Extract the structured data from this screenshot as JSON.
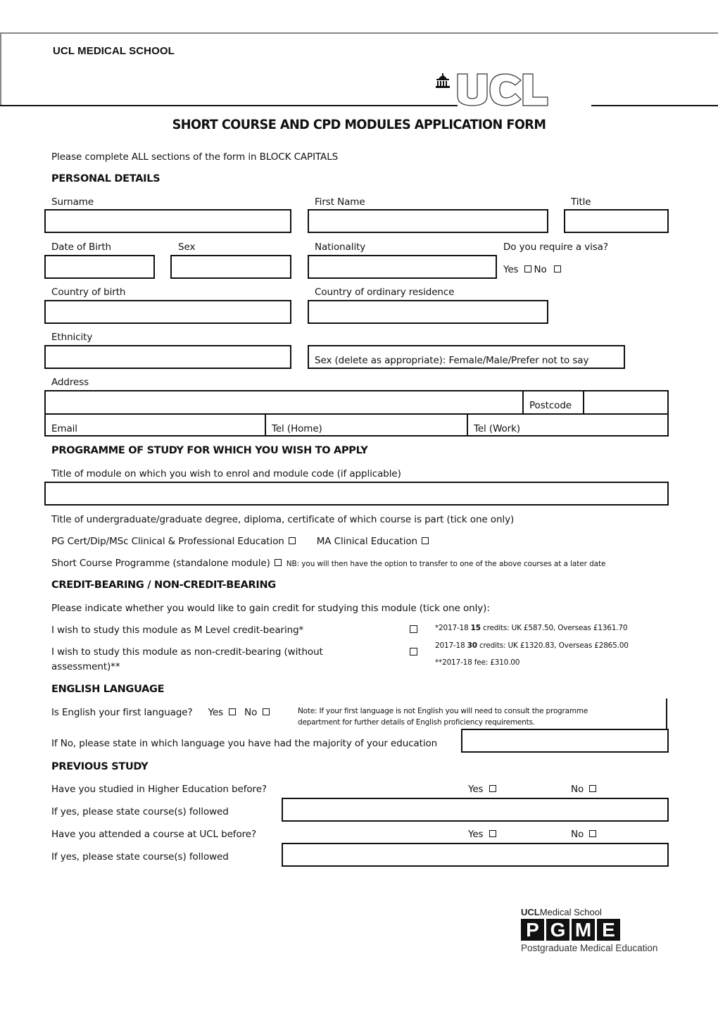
{
  "header": {
    "school": "UCL MEDICAL SCHOOL",
    "logo_text": "UCL",
    "form_title": "SHORT COURSE AND CPD MODULES APPLICATION FORM"
  },
  "instruction": "Please complete ALL sections of the form in BLOCK CAPITALS",
  "personal": {
    "heading": "PERSONAL DETAILS",
    "surname": "Surname",
    "first_name": "First Name",
    "title": "Title",
    "dob": "Date of Birth",
    "sex": "Sex",
    "nationality": "Nationality",
    "visa_question": "Do you require a visa?",
    "yes": "Yes",
    "no": "No",
    "country_birth": "Country of birth",
    "country_residence": "Country of ordinary residence",
    "ethnicity": "Ethnicity",
    "sex_delete": "Sex (delete as appropriate): Female/Male/Prefer not to say",
    "address": "Address",
    "postcode": "Postcode",
    "email": "Email",
    "tel_home": "Tel (Home)",
    "tel_work": "Tel (Work)"
  },
  "programme": {
    "heading": "PROGRAMME OF STUDY FOR WHICH YOU WISH TO APPLY",
    "module_title": "Title of module on which you wish to enrol and module code (if applicable)",
    "degree_title": "Title of undergraduate/graduate degree, diploma, certificate of which course is part (tick one only)",
    "option_pg": "PG Cert/Dip/MSc Clinical & Professional Education",
    "option_ma": "MA Clinical Education",
    "option_short": "Short Course Programme (standalone module)",
    "nb": "NB: you will then have the option to transfer to one of the above courses at a later date"
  },
  "credit": {
    "heading": "CREDIT-BEARING / NON-CREDIT-BEARING",
    "intro": "Please indicate whether you would like to gain credit for studying this module (tick one only):",
    "option_m": "I wish to study this module as M Level credit-bearing*",
    "option_non_1": "I wish to study this module as non-credit-bearing (without",
    "option_non_2": "assessment)**",
    "fee1_pre": "*2017-18 ",
    "fee1_bold": "15",
    "fee1_post": " credits: UK £587.50, Overseas £1361.70",
    "fee2_pre": "2017-18 ",
    "fee2_bold": "30",
    "fee2_post": " credits: UK £1320.83, Overseas £2865.00",
    "fee3": "**2017-18 fee: £310.00"
  },
  "english": {
    "heading": "ENGLISH LANGUAGE",
    "question": "Is English your first language?",
    "yes": "Yes",
    "no": "No",
    "note_1": "Note: If your first language is not English you will need to consult the programme",
    "note_2": "department for further details of English proficiency requirements.",
    "if_no": "If No, please state in which language you have had the majority of your education"
  },
  "previous": {
    "heading": "PREVIOUS STUDY",
    "q1": "Have you studied in Higher Education before?",
    "q1_followed": "If yes, please state course(s) followed",
    "q2": "Have you attended a course at UCL before?",
    "q2_followed": "If yes, please state course(s) followed",
    "yes": "Yes",
    "no": "No"
  },
  "footer_logo": {
    "ucl": "UCL",
    "medical_school": "Medical School",
    "letters": [
      "P",
      "G",
      "M",
      "E"
    ],
    "subtitle": "Postgraduate Medical Education"
  }
}
